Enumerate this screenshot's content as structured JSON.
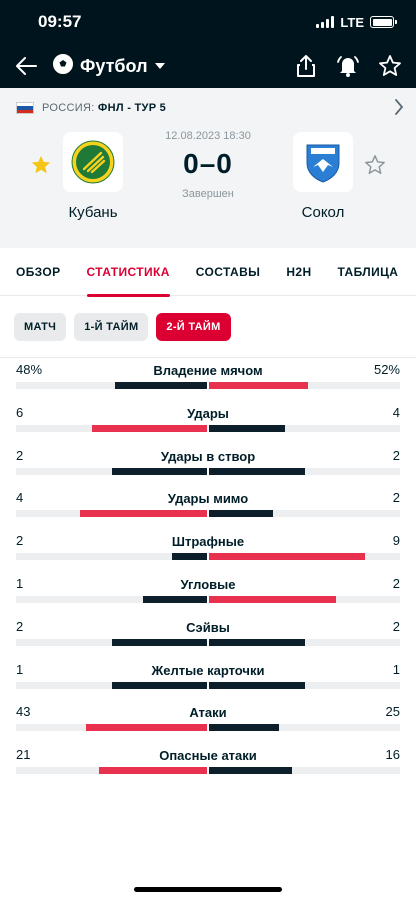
{
  "status_bar": {
    "time": "09:57",
    "network": "LTE"
  },
  "header": {
    "sport": "Футбол"
  },
  "league": {
    "country": "РОССИЯ:",
    "name": "ФНЛ - ТУР 5"
  },
  "match": {
    "datetime": "12.08.2023 18:30",
    "score": "0–0",
    "status": "Завершен",
    "home": {
      "name": "Кубань",
      "favorite": true
    },
    "away": {
      "name": "Сокол",
      "favorite": false
    }
  },
  "tabs": [
    {
      "label": "ОБЗОР",
      "active": false
    },
    {
      "label": "СТАТИСТИКА",
      "active": true
    },
    {
      "label": "СОСТАВЫ",
      "active": false
    },
    {
      "label": "H2H",
      "active": false
    },
    {
      "label": "ТАБЛИЦА",
      "active": false
    }
  ],
  "periods": [
    {
      "label": "МАТЧ",
      "active": false
    },
    {
      "label": "1-Й ТАЙМ",
      "active": false
    },
    {
      "label": "2-Й ТАЙМ",
      "active": true
    }
  ],
  "stats": [
    {
      "label": "Владение мячом",
      "home": "48%",
      "away": "52%",
      "home_value": 48,
      "away_value": 52
    },
    {
      "label": "Удары",
      "home": "6",
      "away": "4",
      "home_value": 6,
      "away_value": 4
    },
    {
      "label": "Удары в створ",
      "home": "2",
      "away": "2",
      "home_value": 2,
      "away_value": 2
    },
    {
      "label": "Удары мимо",
      "home": "4",
      "away": "2",
      "home_value": 4,
      "away_value": 2
    },
    {
      "label": "Штрафные",
      "home": "2",
      "away": "9",
      "home_value": 2,
      "away_value": 9
    },
    {
      "label": "Угловые",
      "home": "1",
      "away": "2",
      "home_value": 1,
      "away_value": 2
    },
    {
      "label": "Сэйвы",
      "home": "2",
      "away": "2",
      "home_value": 2,
      "away_value": 2
    },
    {
      "label": "Желтые карточки",
      "home": "1",
      "away": "1",
      "home_value": 1,
      "away_value": 1
    },
    {
      "label": "Атаки",
      "home": "43",
      "away": "25",
      "home_value": 43,
      "away_value": 25
    },
    {
      "label": "Опасные атаки",
      "home": "21",
      "away": "16",
      "home_value": 21,
      "away_value": 16
    }
  ],
  "colors": {
    "accent": "#dc0032",
    "win_bar": "#e8314f",
    "lose_bar": "#0c1f2b",
    "header_bg": "#00141e"
  }
}
